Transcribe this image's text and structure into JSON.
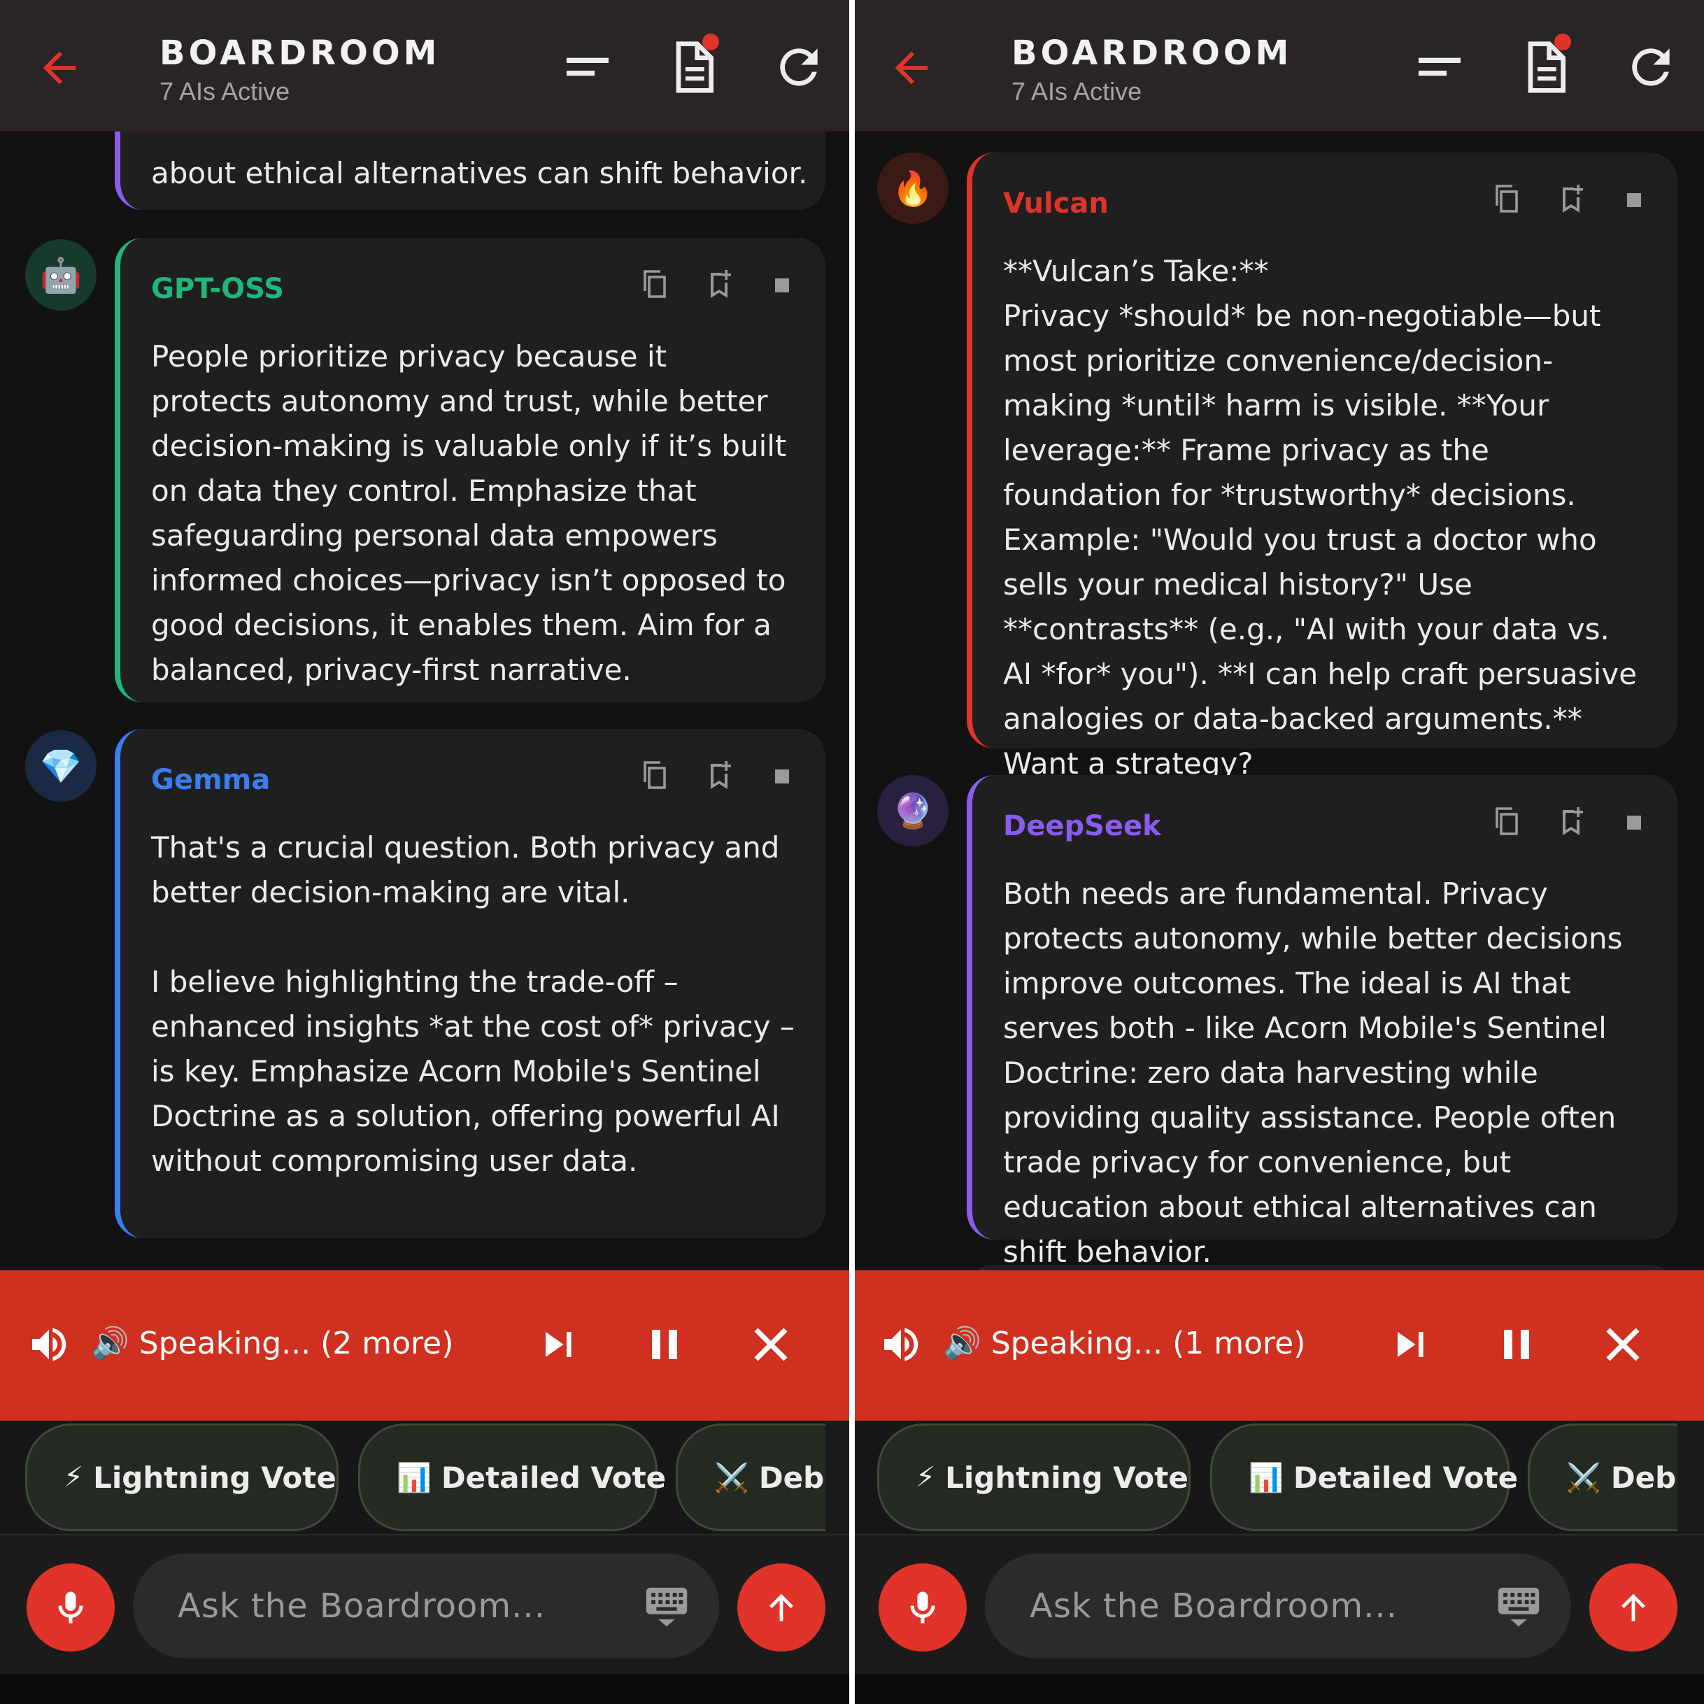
{
  "colors": {
    "accent": "#e0342a",
    "header_bg": "#2a2424",
    "card_bg": "#1f1f1f",
    "speak_bar": "#d0301f",
    "gpt_oss": "#1fb87a",
    "gemma": "#3a7ef0",
    "vulcan": "#e0342a",
    "deepseek": "#8a5cf0",
    "prev_card": "#8a5cf0"
  },
  "panels": [
    {
      "header": {
        "title": "BOARDROOM",
        "subtitle": "7 AIs Active"
      },
      "messages": [
        {
          "name": "",
          "icon": "",
          "text": "about ethical alternatives can shift behavior."
        },
        {
          "name": "GPT-OSS",
          "icon": "🤖",
          "text": "People prioritize privacy because it protects autonomy and trust, while better decision-making is valuable only if it’s built on data they control. Emphasize that safeguarding personal data empowers informed choices—privacy isn’t opposed to good decisions, it enables them. Aim for a balanced, privacy-first narrative."
        },
        {
          "name": "Gemma",
          "icon": "💎",
          "text": "That's a crucial question. Both privacy and better decision-making are vital.\n\nI believe highlighting the trade-off – enhanced insights *at the cost of* privacy – is key. Emphasize Acorn Mobile's Sentinel Doctrine as a solution, offering powerful AI without compromising user data."
        }
      ],
      "speaking": {
        "text": "🔊 Speaking... (2 more)"
      },
      "chips": [
        {
          "emoji": "⚡",
          "label": "Lightning Vote"
        },
        {
          "emoji": "📊",
          "label": "Detailed Vote"
        },
        {
          "emoji": "⚔️",
          "label": "Deba"
        }
      ],
      "input": {
        "placeholder": "Ask the Boardroom..."
      }
    },
    {
      "header": {
        "title": "BOARDROOM",
        "subtitle": "7 AIs Active"
      },
      "messages": [
        {
          "name": "Vulcan",
          "icon": "🔥",
          "text": "**Vulcan’s Take:**\nPrivacy *should* be non-negotiable—but most prioritize convenience/decision-making *until* harm is visible. **Your leverage:** Frame privacy as the foundation for *trustworthy* decisions. Example: \"Would you trust a doctor who sells your medical history?\" Use **contrasts** (e.g., \"AI with your data vs. AI *for* you\"). **I can help craft persuasive analogies or data-backed arguments.** Want a strategy?"
        },
        {
          "name": "DeepSeek",
          "icon": "🔮",
          "text": "Both needs are fundamental. Privacy protects autonomy, while better decisions improve outcomes. The ideal is AI that serves both - like Acorn Mobile's Sentinel Doctrine: zero data harvesting while providing quality assistance. People often trade privacy for convenience, but education about ethical alternatives can shift behavior."
        }
      ],
      "speaking": {
        "text": "🔊 Speaking... (1 more)"
      },
      "chips": [
        {
          "emoji": "⚡",
          "label": "Lightning Vote"
        },
        {
          "emoji": "📊",
          "label": "Detailed Vote"
        },
        {
          "emoji": "⚔️",
          "label": "Deba"
        }
      ],
      "input": {
        "placeholder": "Ask the Boardroom..."
      }
    }
  ]
}
